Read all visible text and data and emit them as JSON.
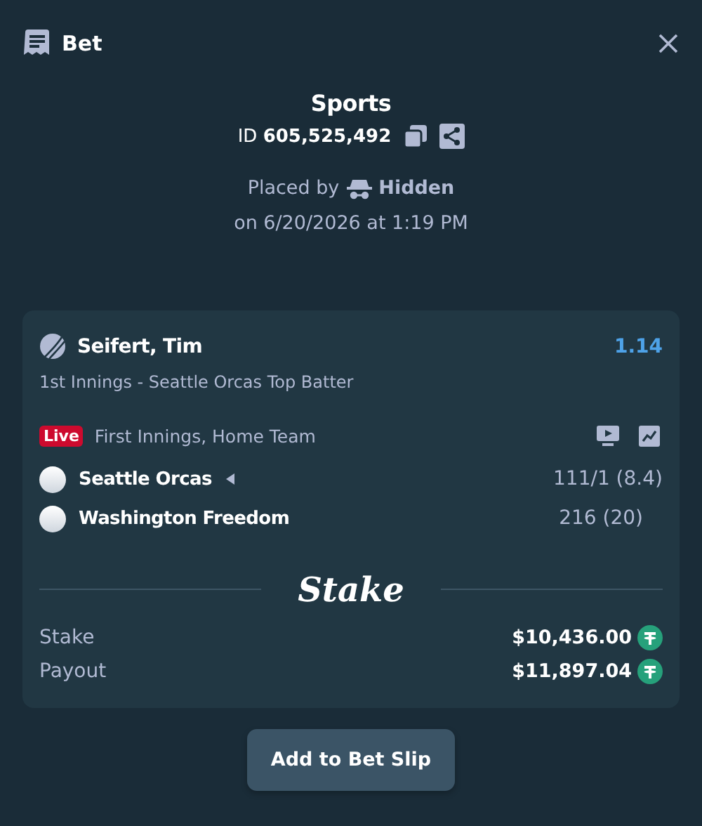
{
  "header": {
    "title": "Bet"
  },
  "summary": {
    "category": "Sports",
    "id_label": "ID",
    "id_value": "605,525,492",
    "placed_by": "Placed by",
    "user": "Hidden",
    "placed_on": "on 6/20/2026 at 1:19 PM"
  },
  "selection": {
    "player": "Seifert, Tim",
    "odds": "1.14",
    "market": "1st Innings - Seattle Orcas Top Batter",
    "badge": "Live",
    "status": "First Innings, Home Team",
    "teams": [
      {
        "name": "Seattle Orcas",
        "batting": true,
        "score": "111/1 (8.4)"
      },
      {
        "name": "Washington Freedom",
        "batting": false,
        "score": "216 (20)"
      }
    ]
  },
  "brand": "Stake",
  "amounts": [
    {
      "label": "Stake",
      "value": "$10,436.00"
    },
    {
      "label": "Payout",
      "value": "$11,897.04"
    }
  ],
  "button": "Add to Bet Slip"
}
